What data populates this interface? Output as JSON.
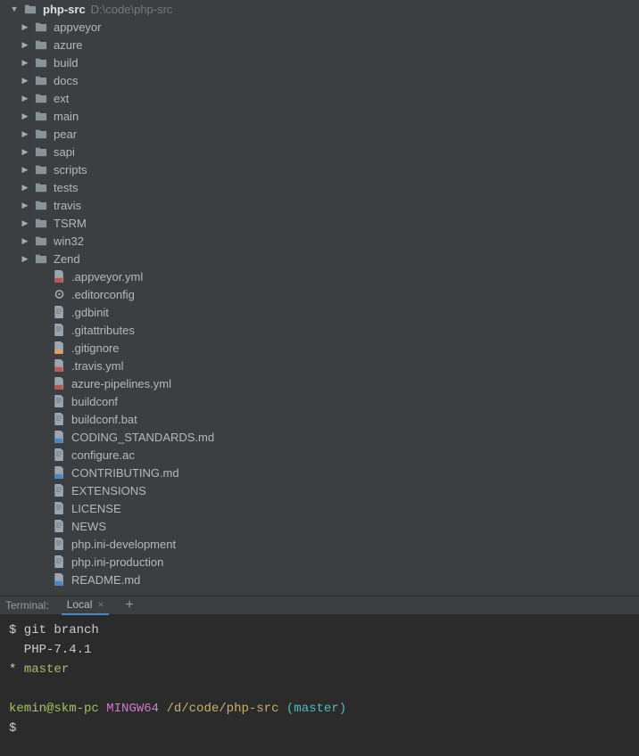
{
  "root": {
    "name": "php-src",
    "path": "D:\\code\\php-src"
  },
  "folders": [
    {
      "name": "appveyor"
    },
    {
      "name": "azure"
    },
    {
      "name": "build"
    },
    {
      "name": "docs"
    },
    {
      "name": "ext"
    },
    {
      "name": "main"
    },
    {
      "name": "pear"
    },
    {
      "name": "sapi"
    },
    {
      "name": "scripts"
    },
    {
      "name": "tests"
    },
    {
      "name": "travis"
    },
    {
      "name": "TSRM"
    },
    {
      "name": "win32"
    },
    {
      "name": "Zend"
    }
  ],
  "files": [
    {
      "name": ".appveyor.yml",
      "icon": "yml"
    },
    {
      "name": ".editorconfig",
      "icon": "gear"
    },
    {
      "name": ".gdbinit",
      "icon": "text"
    },
    {
      "name": ".gitattributes",
      "icon": "text"
    },
    {
      "name": ".gitignore",
      "icon": "ignore"
    },
    {
      "name": ".travis.yml",
      "icon": "yml"
    },
    {
      "name": "azure-pipelines.yml",
      "icon": "yml"
    },
    {
      "name": "buildconf",
      "icon": "text"
    },
    {
      "name": "buildconf.bat",
      "icon": "text"
    },
    {
      "name": "CODING_STANDARDS.md",
      "icon": "md"
    },
    {
      "name": "configure.ac",
      "icon": "text"
    },
    {
      "name": "CONTRIBUTING.md",
      "icon": "md"
    },
    {
      "name": "EXTENSIONS",
      "icon": "text"
    },
    {
      "name": "LICENSE",
      "icon": "text"
    },
    {
      "name": "NEWS",
      "icon": "text"
    },
    {
      "name": "php.ini-development",
      "icon": "text"
    },
    {
      "name": "php.ini-production",
      "icon": "text"
    },
    {
      "name": "README.md",
      "icon": "md"
    }
  ],
  "terminal": {
    "panel_label": "Terminal:",
    "tab_label": "Local",
    "lines": [
      {
        "segs": [
          {
            "t": "$ git branch",
            "c": ""
          }
        ]
      },
      {
        "segs": [
          {
            "t": "  PHP-7.4.1",
            "c": ""
          }
        ]
      },
      {
        "segs": [
          {
            "t": "* ",
            "c": ""
          },
          {
            "t": "master",
            "c": "t-green"
          }
        ]
      },
      {
        "segs": [
          {
            "t": " ",
            "c": ""
          }
        ]
      },
      {
        "segs": [
          {
            "t": "kemin@skm-pc",
            "c": "t-green"
          },
          {
            "t": " ",
            "c": ""
          },
          {
            "t": "MINGW64",
            "c": "t-purple"
          },
          {
            "t": " ",
            "c": ""
          },
          {
            "t": "/d/code/php-src",
            "c": "t-yellow"
          },
          {
            "t": " ",
            "c": ""
          },
          {
            "t": "(master)",
            "c": "t-cyan"
          }
        ]
      },
      {
        "segs": [
          {
            "t": "$",
            "c": ""
          }
        ]
      }
    ]
  }
}
